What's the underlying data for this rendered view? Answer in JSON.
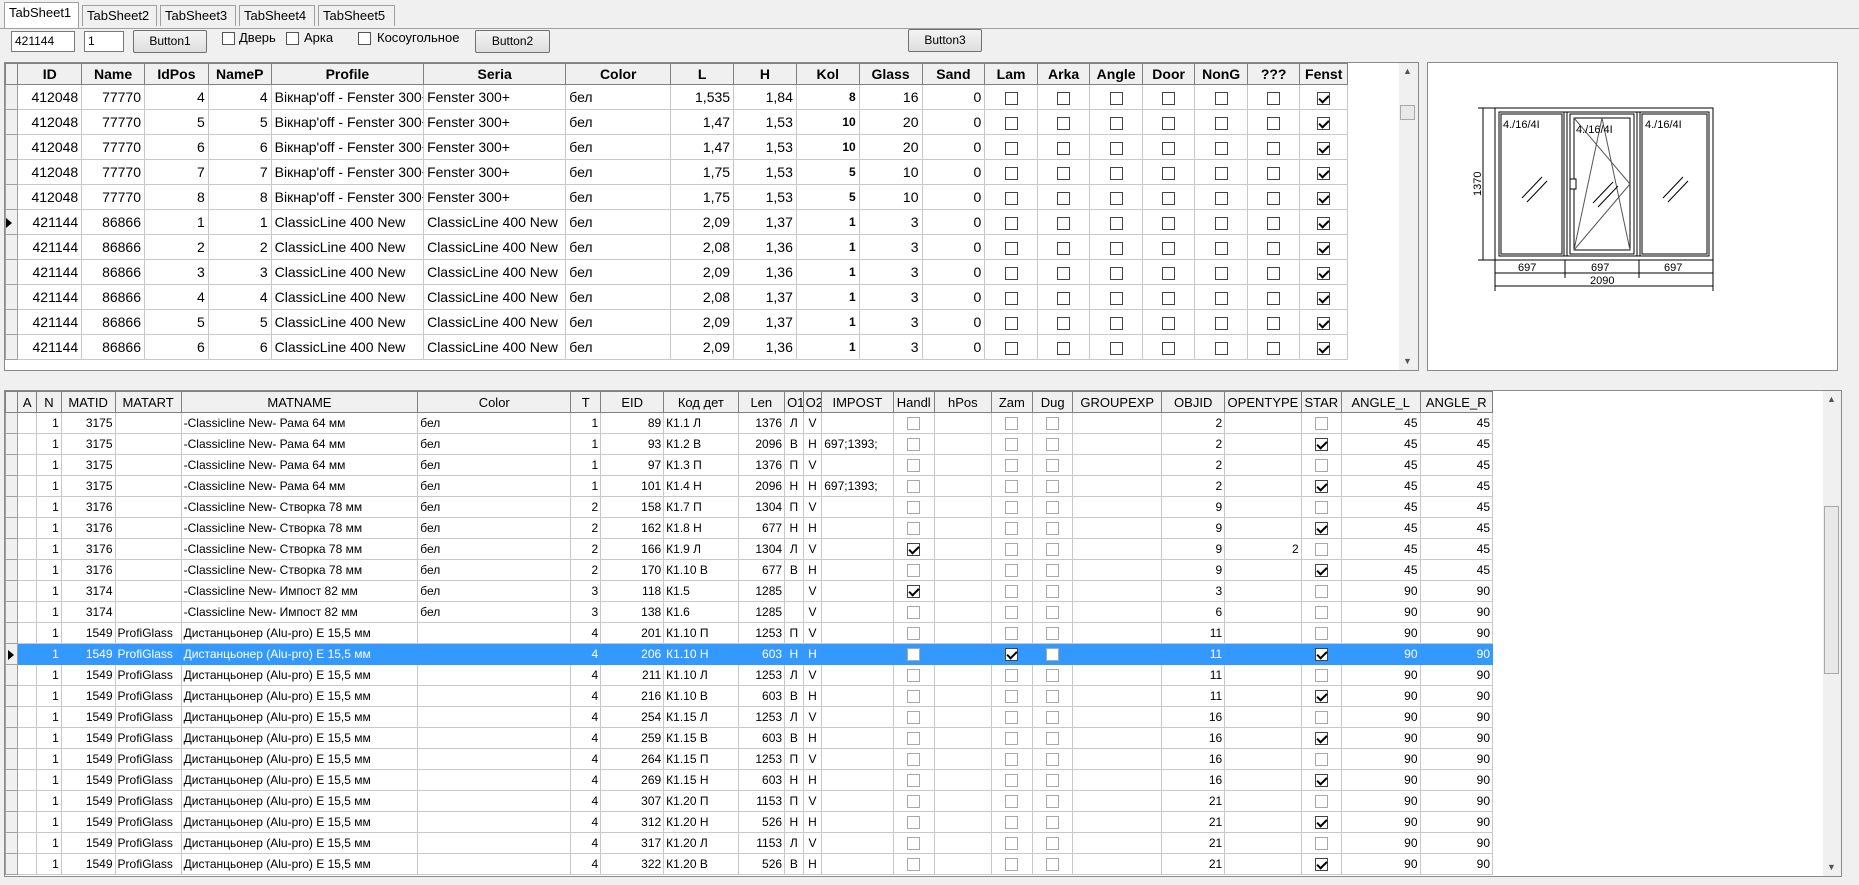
{
  "tabs": [
    "TabSheet1",
    "TabSheet2",
    "TabSheet3",
    "TabSheet4",
    "TabSheet5"
  ],
  "toolbar": {
    "order_id": "421144",
    "pos": "1",
    "button1": "Button1",
    "button2": "Button2",
    "button3": "Button3",
    "chk_door": "Дверь",
    "chk_arch": "Арка",
    "chk_oblique": "Косоугольное"
  },
  "grid1": {
    "columns": [
      "ID",
      "Name",
      "IdPos",
      "NameP",
      "Profile",
      "Seria",
      "Color",
      "L",
      "H",
      "Kol",
      "Glass",
      "Sand",
      "Lam",
      "Arka",
      "Angle",
      "Door",
      "NonG",
      "???",
      "Fenst"
    ],
    "rows": [
      {
        "id": "412048",
        "name": "77770",
        "idpos": "4",
        "namep": "4",
        "profile": "Вікнар'off - Fenster 300+",
        "seria": "Fenster 300+",
        "color": "бел",
        "l": "1,535",
        "h": "1,84",
        "kol": "8",
        "glass": "16",
        "sand": "0",
        "current": false
      },
      {
        "id": "412048",
        "name": "77770",
        "idpos": "5",
        "namep": "5",
        "profile": "Вікнар'off - Fenster 300+",
        "seria": "Fenster 300+",
        "color": "бел",
        "l": "1,47",
        "h": "1,53",
        "kol": "10",
        "glass": "20",
        "sand": "0",
        "current": false
      },
      {
        "id": "412048",
        "name": "77770",
        "idpos": "6",
        "namep": "6",
        "profile": "Вікнар'off - Fenster 300+",
        "seria": "Fenster 300+",
        "color": "бел",
        "l": "1,47",
        "h": "1,53",
        "kol": "10",
        "glass": "20",
        "sand": "0",
        "current": false
      },
      {
        "id": "412048",
        "name": "77770",
        "idpos": "7",
        "namep": "7",
        "profile": "Вікнар'off - Fenster 300+",
        "seria": "Fenster 300+",
        "color": "бел",
        "l": "1,75",
        "h": "1,53",
        "kol": "5",
        "glass": "10",
        "sand": "0",
        "current": false
      },
      {
        "id": "412048",
        "name": "77770",
        "idpos": "8",
        "namep": "8",
        "profile": "Вікнар'off - Fenster 300+",
        "seria": "Fenster 300+",
        "color": "бел",
        "l": "1,75",
        "h": "1,53",
        "kol": "5",
        "glass": "10",
        "sand": "0",
        "current": false
      },
      {
        "id": "421144",
        "name": "86866",
        "idpos": "1",
        "namep": "1",
        "profile": "ClassicLine 400 New",
        "seria": "ClassicLine 400 New",
        "color": "бел",
        "l": "2,09",
        "h": "1,37",
        "kol": "1",
        "glass": "3",
        "sand": "0",
        "current": true
      },
      {
        "id": "421144",
        "name": "86866",
        "idpos": "2",
        "namep": "2",
        "profile": "ClassicLine 400 New",
        "seria": "ClassicLine 400 New",
        "color": "бел",
        "l": "2,08",
        "h": "1,36",
        "kol": "1",
        "glass": "3",
        "sand": "0",
        "current": false
      },
      {
        "id": "421144",
        "name": "86866",
        "idpos": "3",
        "namep": "3",
        "profile": "ClassicLine 400 New",
        "seria": "ClassicLine 400 New",
        "color": "бел",
        "l": "2,09",
        "h": "1,36",
        "kol": "1",
        "glass": "3",
        "sand": "0",
        "current": false
      },
      {
        "id": "421144",
        "name": "86866",
        "idpos": "4",
        "namep": "4",
        "profile": "ClassicLine 400 New",
        "seria": "ClassicLine 400 New",
        "color": "бел",
        "l": "2,08",
        "h": "1,37",
        "kol": "1",
        "glass": "3",
        "sand": "0",
        "current": false
      },
      {
        "id": "421144",
        "name": "86866",
        "idpos": "5",
        "namep": "5",
        "profile": "ClassicLine 400 New",
        "seria": "ClassicLine 400 New",
        "color": "бел",
        "l": "2,09",
        "h": "1,37",
        "kol": "1",
        "glass": "3",
        "sand": "0",
        "current": false
      },
      {
        "id": "421144",
        "name": "86866",
        "idpos": "6",
        "namep": "6",
        "profile": "ClassicLine 400 New",
        "seria": "ClassicLine 400 New",
        "color": "бел",
        "l": "2,09",
        "h": "1,36",
        "kol": "1",
        "glass": "3",
        "sand": "0",
        "current": false
      }
    ]
  },
  "drawing": {
    "height_label": "1370",
    "width_label": "2090",
    "seg1": "697",
    "seg2": "697",
    "seg3": "697",
    "glass1": "4./16/4I",
    "glass2": "4./16/4I",
    "glass3": "4./16/4I"
  },
  "grid2": {
    "columns": [
      "A",
      "N",
      "MATID",
      "MATART",
      "MATNAME",
      "Color",
      "T",
      "EID",
      "Код дет",
      "Len",
      "O1",
      "O2",
      "IMPOST",
      "Handl",
      "hPos",
      "Zam",
      "Dug",
      "GROUPEXP",
      "OBJID",
      "OPENTYPE",
      "STAR",
      "ANGLE_L",
      "ANGLE_R"
    ],
    "rows": [
      {
        "n": "1",
        "matid": "3175",
        "matart": "",
        "matname": "-Classicline New- Рама 64 мм",
        "color": "бел",
        "t": "1",
        "eid": "89",
        "kod": "К1.1 Л",
        "len": "1376",
        "o1": "Л",
        "o2": "V",
        "impost": "",
        "handl": false,
        "zam": false,
        "dug": false,
        "objid": "2",
        "opentype": "",
        "star": false,
        "al": "45",
        "ar": "45"
      },
      {
        "n": "1",
        "matid": "3175",
        "matart": "",
        "matname": "-Classicline New- Рама 64 мм",
        "color": "бел",
        "t": "1",
        "eid": "93",
        "kod": "К1.2 В",
        "len": "2096",
        "o1": "В",
        "o2": "H",
        "impost": "697;1393;",
        "handl": false,
        "zam": false,
        "dug": false,
        "objid": "2",
        "opentype": "",
        "star": true,
        "al": "45",
        "ar": "45"
      },
      {
        "n": "1",
        "matid": "3175",
        "matart": "",
        "matname": "-Classicline New- Рама 64 мм",
        "color": "бел",
        "t": "1",
        "eid": "97",
        "kod": "К1.3 П",
        "len": "1376",
        "o1": "П",
        "o2": "V",
        "impost": "",
        "handl": false,
        "zam": false,
        "dug": false,
        "objid": "2",
        "opentype": "",
        "star": false,
        "al": "45",
        "ar": "45"
      },
      {
        "n": "1",
        "matid": "3175",
        "matart": "",
        "matname": "-Classicline New- Рама 64 мм",
        "color": "бел",
        "t": "1",
        "eid": "101",
        "kod": "К1.4 Н",
        "len": "2096",
        "o1": "Н",
        "o2": "H",
        "impost": "697;1393;",
        "handl": false,
        "zam": false,
        "dug": false,
        "objid": "2",
        "opentype": "",
        "star": true,
        "al": "45",
        "ar": "45"
      },
      {
        "n": "1",
        "matid": "3176",
        "matart": "",
        "matname": "-Classicline New- Створка 78 мм",
        "color": "бел",
        "t": "2",
        "eid": "158",
        "kod": "К1.7 П",
        "len": "1304",
        "o1": "П",
        "o2": "V",
        "impost": "",
        "handl": false,
        "zam": false,
        "dug": false,
        "objid": "9",
        "opentype": "",
        "star": false,
        "al": "45",
        "ar": "45"
      },
      {
        "n": "1",
        "matid": "3176",
        "matart": "",
        "matname": "-Classicline New- Створка 78 мм",
        "color": "бел",
        "t": "2",
        "eid": "162",
        "kod": "К1.8 Н",
        "len": "677",
        "o1": "Н",
        "o2": "H",
        "impost": "",
        "handl": false,
        "zam": false,
        "dug": false,
        "objid": "9",
        "opentype": "",
        "star": true,
        "al": "45",
        "ar": "45"
      },
      {
        "n": "1",
        "matid": "3176",
        "matart": "",
        "matname": "-Classicline New- Створка 78 мм",
        "color": "бел",
        "t": "2",
        "eid": "166",
        "kod": "К1.9 Л",
        "len": "1304",
        "o1": "Л",
        "o2": "V",
        "impost": "",
        "handl": true,
        "zam": false,
        "dug": false,
        "objid": "9",
        "opentype": "2",
        "star": false,
        "al": "45",
        "ar": "45"
      },
      {
        "n": "1",
        "matid": "3176",
        "matart": "",
        "matname": "-Classicline New- Створка 78 мм",
        "color": "бел",
        "t": "2",
        "eid": "170",
        "kod": "К1.10 В",
        "len": "677",
        "o1": "В",
        "o2": "H",
        "impost": "",
        "handl": false,
        "zam": false,
        "dug": false,
        "objid": "9",
        "opentype": "",
        "star": true,
        "al": "45",
        "ar": "45"
      },
      {
        "n": "1",
        "matid": "3174",
        "matart": "",
        "matname": "-Classicline New- Импост 82 мм",
        "color": "бел",
        "t": "3",
        "eid": "118",
        "kod": "К1.5",
        "len": "1285",
        "o1": "",
        "o2": "V",
        "impost": "",
        "handl": true,
        "zam": false,
        "dug": false,
        "objid": "3",
        "opentype": "",
        "star": false,
        "al": "90",
        "ar": "90"
      },
      {
        "n": "1",
        "matid": "3174",
        "matart": "",
        "matname": "-Classicline New- Импост 82 мм",
        "color": "бел",
        "t": "3",
        "eid": "138",
        "kod": "К1.6",
        "len": "1285",
        "o1": "",
        "o2": "V",
        "impost": "",
        "handl": false,
        "zam": false,
        "dug": false,
        "objid": "6",
        "opentype": "",
        "star": false,
        "al": "90",
        "ar": "90"
      },
      {
        "n": "1",
        "matid": "1549",
        "matart": "ProfiGlass",
        "matname": "Дистанцьонер (Alu-pro) E 15,5 мм",
        "color": "",
        "t": "4",
        "eid": "201",
        "kod": "К1.10 П",
        "len": "1253",
        "o1": "П",
        "o2": "V",
        "impost": "",
        "handl": false,
        "zam": false,
        "dug": false,
        "objid": "11",
        "opentype": "",
        "star": false,
        "al": "90",
        "ar": "90"
      },
      {
        "n": "1",
        "matid": "1549",
        "matart": "ProfiGlass",
        "matname": "Дистанцьонер (Alu-pro) E 15,5 мм",
        "color": "",
        "t": "4",
        "eid": "206",
        "kod": "К1.10 Н",
        "len": "603",
        "o1": "Н",
        "o2": "H",
        "impost": "",
        "handl": false,
        "zam": true,
        "dug": false,
        "objid": "11",
        "opentype": "",
        "star": true,
        "al": "90",
        "ar": "90",
        "selected": true
      },
      {
        "n": "1",
        "matid": "1549",
        "matart": "ProfiGlass",
        "matname": "Дистанцьонер (Alu-pro) E 15,5 мм",
        "color": "",
        "t": "4",
        "eid": "211",
        "kod": "К1.10 Л",
        "len": "1253",
        "o1": "Л",
        "o2": "V",
        "impost": "",
        "handl": false,
        "zam": false,
        "dug": false,
        "objid": "11",
        "opentype": "",
        "star": false,
        "al": "90",
        "ar": "90"
      },
      {
        "n": "1",
        "matid": "1549",
        "matart": "ProfiGlass",
        "matname": "Дистанцьонер (Alu-pro) E 15,5 мм",
        "color": "",
        "t": "4",
        "eid": "216",
        "kod": "К1.10 В",
        "len": "603",
        "o1": "В",
        "o2": "H",
        "impost": "",
        "handl": false,
        "zam": false,
        "dug": false,
        "objid": "11",
        "opentype": "",
        "star": true,
        "al": "90",
        "ar": "90"
      },
      {
        "n": "1",
        "matid": "1549",
        "matart": "ProfiGlass",
        "matname": "Дистанцьонер (Alu-pro) E 15,5 мм",
        "color": "",
        "t": "4",
        "eid": "254",
        "kod": "К1.15 Л",
        "len": "1253",
        "o1": "Л",
        "o2": "V",
        "impost": "",
        "handl": false,
        "zam": false,
        "dug": false,
        "objid": "16",
        "opentype": "",
        "star": false,
        "al": "90",
        "ar": "90"
      },
      {
        "n": "1",
        "matid": "1549",
        "matart": "ProfiGlass",
        "matname": "Дистанцьонер (Alu-pro) E 15,5 мм",
        "color": "",
        "t": "4",
        "eid": "259",
        "kod": "К1.15 В",
        "len": "603",
        "o1": "В",
        "o2": "H",
        "impost": "",
        "handl": false,
        "zam": false,
        "dug": false,
        "objid": "16",
        "opentype": "",
        "star": true,
        "al": "90",
        "ar": "90"
      },
      {
        "n": "1",
        "matid": "1549",
        "matart": "ProfiGlass",
        "matname": "Дистанцьонер (Alu-pro) E 15,5 мм",
        "color": "",
        "t": "4",
        "eid": "264",
        "kod": "К1.15 П",
        "len": "1253",
        "o1": "П",
        "o2": "V",
        "impost": "",
        "handl": false,
        "zam": false,
        "dug": false,
        "objid": "16",
        "opentype": "",
        "star": false,
        "al": "90",
        "ar": "90"
      },
      {
        "n": "1",
        "matid": "1549",
        "matart": "ProfiGlass",
        "matname": "Дистанцьонер (Alu-pro) E 15,5 мм",
        "color": "",
        "t": "4",
        "eid": "269",
        "kod": "К1.15 Н",
        "len": "603",
        "o1": "Н",
        "o2": "H",
        "impost": "",
        "handl": false,
        "zam": false,
        "dug": false,
        "objid": "16",
        "opentype": "",
        "star": true,
        "al": "90",
        "ar": "90"
      },
      {
        "n": "1",
        "matid": "1549",
        "matart": "ProfiGlass",
        "matname": "Дистанцьонер (Alu-pro) E 15,5 мм",
        "color": "",
        "t": "4",
        "eid": "307",
        "kod": "К1.20 П",
        "len": "1153",
        "o1": "П",
        "o2": "V",
        "impost": "",
        "handl": false,
        "zam": false,
        "dug": false,
        "objid": "21",
        "opentype": "",
        "star": false,
        "al": "90",
        "ar": "90"
      },
      {
        "n": "1",
        "matid": "1549",
        "matart": "ProfiGlass",
        "matname": "Дистанцьонер (Alu-pro) E 15,5 мм",
        "color": "",
        "t": "4",
        "eid": "312",
        "kod": "К1.20 Н",
        "len": "526",
        "o1": "Н",
        "o2": "H",
        "impost": "",
        "handl": false,
        "zam": false,
        "dug": false,
        "objid": "21",
        "opentype": "",
        "star": true,
        "al": "90",
        "ar": "90"
      },
      {
        "n": "1",
        "matid": "1549",
        "matart": "ProfiGlass",
        "matname": "Дистанцьонер (Alu-pro) E 15,5 мм",
        "color": "",
        "t": "4",
        "eid": "317",
        "kod": "К1.20 Л",
        "len": "1153",
        "o1": "Л",
        "o2": "V",
        "impost": "",
        "handl": false,
        "zam": false,
        "dug": false,
        "objid": "21",
        "opentype": "",
        "star": false,
        "al": "90",
        "ar": "90"
      },
      {
        "n": "1",
        "matid": "1549",
        "matart": "ProfiGlass",
        "matname": "Дистанцьонер (Alu-pro) E 15,5 мм",
        "color": "",
        "t": "4",
        "eid": "322",
        "kod": "К1.20 В",
        "len": "526",
        "o1": "В",
        "o2": "H",
        "impost": "",
        "handl": false,
        "zam": false,
        "dug": false,
        "objid": "21",
        "opentype": "",
        "star": true,
        "al": "90",
        "ar": "90"
      }
    ]
  },
  "colors": {
    "selection": "#3399ff",
    "face": "#f0f0f0"
  }
}
